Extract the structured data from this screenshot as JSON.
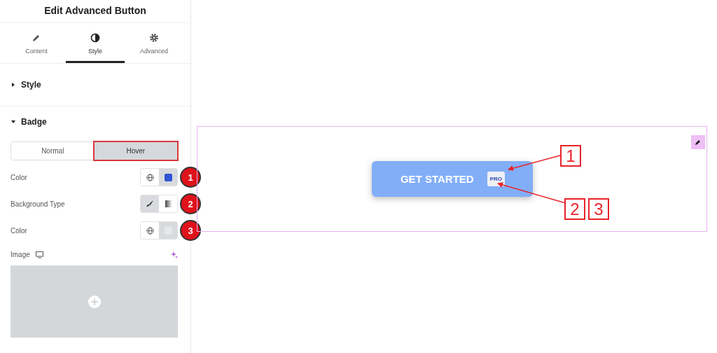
{
  "panel": {
    "title": "Edit Advanced Button",
    "tabs": [
      {
        "label": "Content",
        "kind": "pencil",
        "selected": false
      },
      {
        "label": "Style",
        "kind": "contrast",
        "selected": true
      },
      {
        "label": "Advanced",
        "kind": "gear",
        "selected": false
      }
    ],
    "sections": [
      {
        "title": "Style",
        "expanded": false
      },
      {
        "title": "Badge",
        "expanded": true
      }
    ],
    "state_tabs": [
      {
        "label": "Normal",
        "selected": false
      },
      {
        "label": "Hover",
        "selected": true
      }
    ],
    "controls": [
      {
        "kind": "color",
        "label": "Color",
        "color": "#2f55d4",
        "callout": "1"
      },
      {
        "kind": "background_type",
        "label": "Background Type",
        "options": [
          {
            "kind": "classic",
            "selected": true
          },
          {
            "kind": "gradient",
            "selected": false
          }
        ],
        "callout": "2"
      },
      {
        "kind": "color",
        "label": "Color",
        "color": "#e5e7eb",
        "callout": "3"
      },
      {
        "kind": "image",
        "label": "Image"
      }
    ]
  },
  "canvas": {
    "button": {
      "label": "GET STARTED",
      "badge": "PRO"
    },
    "callouts": [
      {
        "labels": [
          "1"
        ]
      },
      {
        "labels": [
          "2",
          "3"
        ]
      }
    ]
  }
}
